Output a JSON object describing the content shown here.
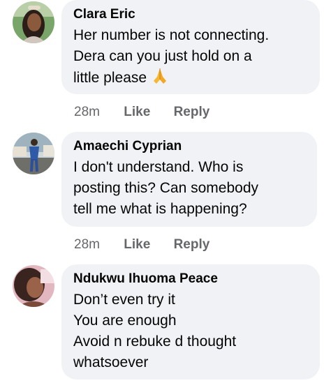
{
  "comments": [
    {
      "author": "Clara Eric",
      "lines": [
        "Her number is not connecting.",
        "Dera can you just hold on a",
        "little please"
      ],
      "emoji": "folded-hands",
      "time": "28m",
      "like": "Like",
      "reply": "Reply"
    },
    {
      "author": "Amaechi Cyprian",
      "lines": [
        "I don't understand. Who is",
        "posting this? Can somebody",
        "tell me what is happening?"
      ],
      "time": "28m",
      "like": "Like",
      "reply": "Reply"
    },
    {
      "author": "Ndukwu Ihuoma Peace",
      "lines": [
        "Don’t even try it",
        "You are enough",
        "Avoid n rebuke d thought",
        "whatsoever"
      ]
    }
  ],
  "colors": {
    "bubble": "#f0f2f5",
    "text": "#050505",
    "meta": "#65676b"
  }
}
